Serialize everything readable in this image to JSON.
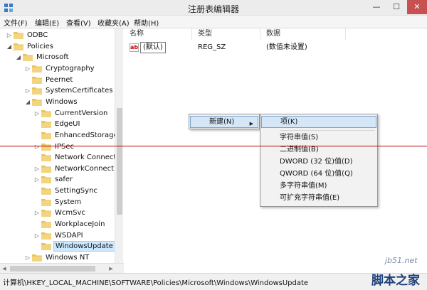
{
  "window": {
    "title": "注册表编辑器",
    "min": "—",
    "max": "☐",
    "close": "✕"
  },
  "menu": [
    "文件(F)",
    "编辑(E)",
    "查看(V)",
    "收藏夹(A)",
    "帮助(H)"
  ],
  "tree": [
    {
      "label": "ODBC",
      "arrow": "▷"
    },
    {
      "label": "Policies",
      "arrow": "◢"
    },
    {
      "label": "Microsoft",
      "arrow": "◢"
    },
    {
      "label": "Cryptography",
      "arrow": "▷"
    },
    {
      "label": "Peernet",
      "arrow": ""
    },
    {
      "label": "SystemCertificates",
      "arrow": "▷"
    },
    {
      "label": "Windows",
      "arrow": "◢"
    },
    {
      "label": "CurrentVersion",
      "arrow": "▷"
    },
    {
      "label": "EdgeUI",
      "arrow": ""
    },
    {
      "label": "EnhancedStorage",
      "arrow": ""
    },
    {
      "label": "IPSec",
      "arrow": "▷"
    },
    {
      "label": "Network Connect",
      "arrow": ""
    },
    {
      "label": "NetworkConnecti",
      "arrow": "▷"
    },
    {
      "label": "safer",
      "arrow": "▷"
    },
    {
      "label": "SettingSync",
      "arrow": ""
    },
    {
      "label": "System",
      "arrow": ""
    },
    {
      "label": "WcmSvc",
      "arrow": "▷"
    },
    {
      "label": "WorkplaceJoin",
      "arrow": ""
    },
    {
      "label": "WSDAPI",
      "arrow": "▷"
    },
    {
      "label": "WindowsUpdate",
      "arrow": "",
      "selected": true
    },
    {
      "label": "Windows NT",
      "arrow": "▷"
    }
  ],
  "columns": {
    "name": "名称",
    "type": "类型",
    "data": "数据"
  },
  "rows": [
    {
      "icon": "ab",
      "name": "(默认)",
      "type": "REG_SZ",
      "data": "(数值未设置)"
    }
  ],
  "context_menu": {
    "new_label": "新建(N)",
    "arrow": "▶"
  },
  "submenu": [
    "项(K)",
    "字符串值(S)",
    "二进制值(B)",
    "DWORD (32 位)值(D)",
    "QWORD (64 位)值(Q)",
    "多字符串值(M)",
    "可扩充字符串值(E)"
  ],
  "status": "计算机\\HKEY_LOCAL_MACHINE\\SOFTWARE\\Policies\\Microsoft\\Windows\\WindowsUpdate",
  "watermark": {
    "site": "jb51.net",
    "name": "脚本之家"
  },
  "colors": {
    "folder": "#e8c25a",
    "selection": "#cce8ff",
    "menu_highlight": "#d5e6f7",
    "red_line": "#c00000"
  }
}
